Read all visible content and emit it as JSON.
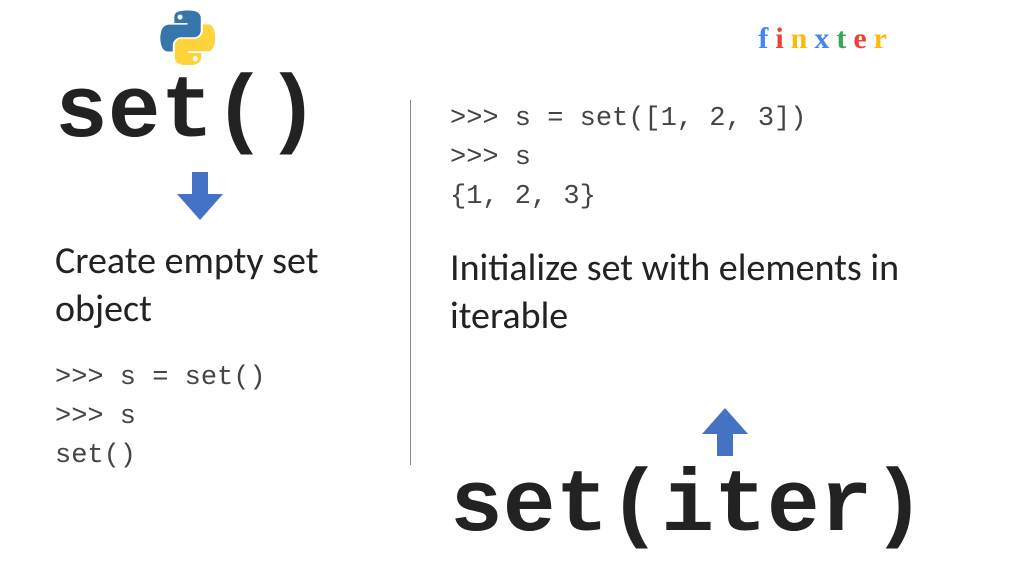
{
  "logo": {
    "letters": [
      "f",
      "i",
      "n",
      "x",
      "t",
      "e",
      "r"
    ]
  },
  "left": {
    "title": "set()",
    "description": "Create empty set object",
    "code": ">>> s = set()\n>>> s\nset()"
  },
  "right": {
    "code": ">>> s = set([1, 2, 3])\n>>> s\n{1, 2, 3}",
    "description": "Initialize set with elements in iterable",
    "title": "set(iter)"
  }
}
